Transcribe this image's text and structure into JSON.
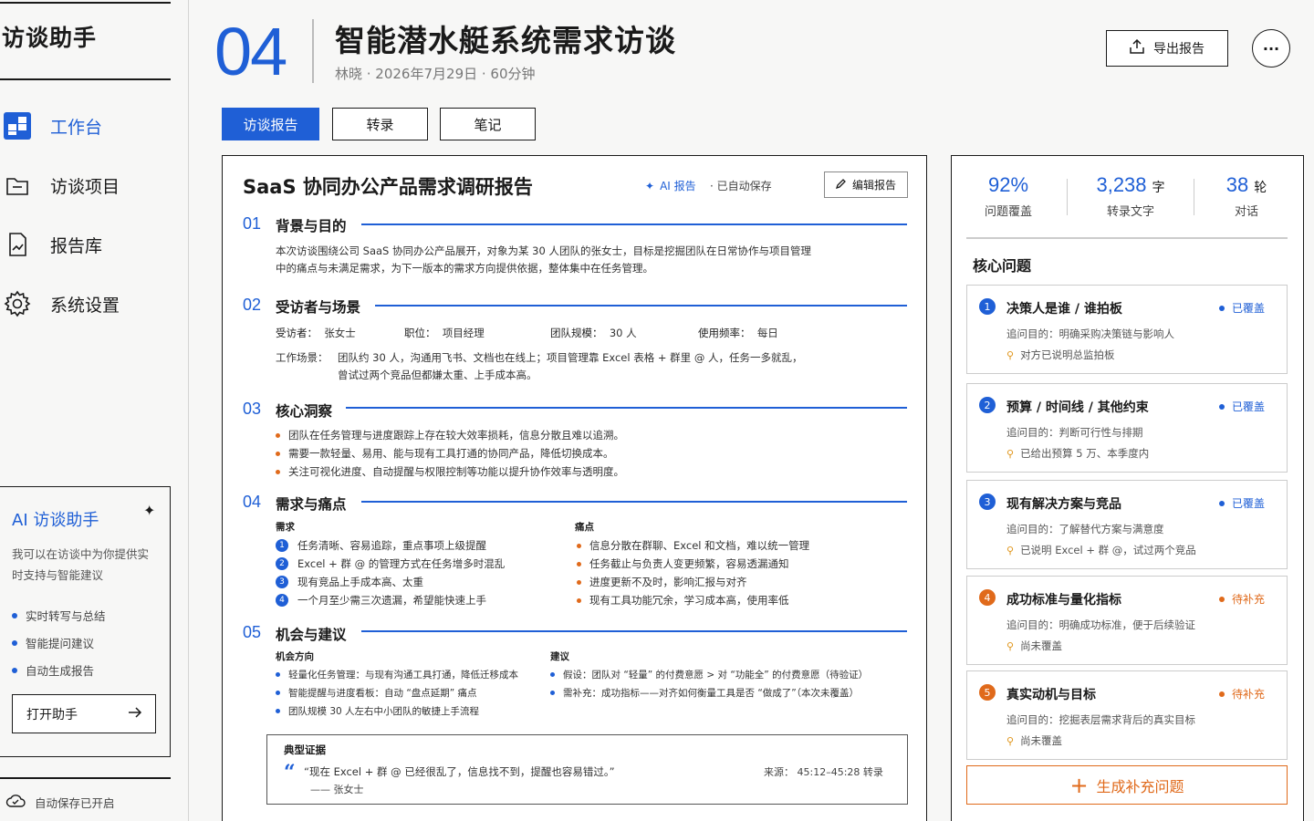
{
  "app": {
    "title": "访谈助手"
  },
  "nav": [
    {
      "label": "工作台",
      "icon": "dashboard-icon",
      "active": true
    },
    {
      "label": "访谈项目",
      "icon": "folder-icon",
      "active": false
    },
    {
      "label": "报告库",
      "icon": "document-chart-icon",
      "active": false
    },
    {
      "label": "系统设置",
      "icon": "gear-icon",
      "active": false
    }
  ],
  "assistant": {
    "title": "AI 访谈助手",
    "desc": "我可以在访谈中为你提供实时支持与智能建议",
    "features": [
      "实时转写与总结",
      "智能提问建议",
      "自动生成报告"
    ],
    "open_label": "打开助手"
  },
  "autosave": "自动保存已开启",
  "header": {
    "number": "04",
    "title": "智能潜水艇系统需求访谈",
    "meta": "林晓  ·  2026年7月29日  ·  60分钟",
    "export_label": "导出报告",
    "more_label": "···"
  },
  "tabs": [
    "访谈报告",
    "转录",
    "笔记"
  ],
  "report": {
    "title": "SaaS 协同办公产品需求调研报告",
    "ai_label": "AI 报告",
    "saved_label": "·  已自动保存",
    "edit_label": "编辑报告",
    "sections": [
      {
        "num": "01",
        "title": "背景与目的"
      },
      {
        "num": "02",
        "title": "受访者与场景"
      },
      {
        "num": "03",
        "title": "核心洞察"
      },
      {
        "num": "04",
        "title": "需求与痛点"
      },
      {
        "num": "05",
        "title": "机会与建议"
      }
    ],
    "background": [
      "本次访谈围绕公司 SaaS 协同办公产品展开，对象为某 30 人团队的张女士，目标是挖掘团队在日常协作与项目管理",
      "中的痛点与未满足需求，为下一版本的需求方向提供依据，整体集中在任务管理。"
    ],
    "interviewee": {
      "name_label": "受访者：",
      "name": "张女士",
      "role_label": "职位：",
      "role": "项目经理",
      "team_label": "团队规模：",
      "team": "30 人",
      "freq_label": "使用频率：",
      "freq": "每日",
      "scene_label": "工作场景：",
      "scene_1": "团队约 30 人，沟通用飞书、文档也在线上；项目管理靠 Excel 表格 + 群里 @ 人，任务一多就乱，",
      "scene_2": "曾试过两个竞品但都嫌太重、上手成本高。"
    },
    "insights": [
      "团队在任务管理与进度跟踪上存在较大效率损耗，信息分散且难以追溯。",
      "需要一款轻量、易用、能与现有工具打通的协同产品，降低切换成本。",
      "关注可视化进度、自动提醒与权限控制等功能以提升协作效率与透明度。"
    ],
    "needs_header": "需求",
    "needs": [
      "任务清晰、容易追踪，重点事项上级提醒",
      "Excel + 群 @ 的管理方式在任务增多时混乱",
      "现有竞品上手成本高、太重",
      "一个月至少需三次遗漏，希望能快速上手"
    ],
    "pains_header": "痛点",
    "pains": [
      "信息分散在群聊、Excel 和文档，难以统一管理",
      "任务截止与负责人变更频繁，容易透漏通知",
      "进度更新不及时，影响汇报与对齐",
      "现有工具功能冗余，学习成本高，使用率低"
    ],
    "opp_header": "机会方向",
    "opportunities": [
      "轻量化任务管理：与现有沟通工具打通，降低迁移成本",
      "智能提醒与进度看板：自动 “盘点延期” 痛点",
      "团队规模 30 人左右中小团队的敏捷上手流程"
    ],
    "sugg_header": "建议",
    "suggestions": [
      "假设：团队对 “轻量” 的付费意愿 > 对 “功能全” 的付费意愿（待验证）",
      "需补充：成功指标——对齐如何衡量工具是否 “做成了”（本次未覆盖）"
    ],
    "evidence": {
      "title": "典型证据",
      "quote": "“现在 Excel + 群 @ 已经很乱了，信息找不到，提醒也容易错过。”",
      "author": "—— 张女士",
      "source": "来源：  45:12–45:28  转录"
    }
  },
  "stats": [
    {
      "value": "92%",
      "unit": "",
      "label": "问题覆盖"
    },
    {
      "value": "3,238",
      "unit": "字",
      "label": "转录文字"
    },
    {
      "value": "38",
      "unit": "轮",
      "label": "对话"
    }
  ],
  "core": {
    "title": "核心问题",
    "questions": [
      {
        "num": "1",
        "title": "决策人是谁 / 谁拍板",
        "status": "已覆盖",
        "purpose": "追问目的：明确采购决策链与影响人",
        "note": "对方已说明总监拍板",
        "color": "#1f5fd6"
      },
      {
        "num": "2",
        "title": "预算 / 时间线 / 其他约束",
        "status": "已覆盖",
        "purpose": "追问目的：判断可行性与排期",
        "note": "已给出预算 5 万、本季度内",
        "color": "#1f5fd6"
      },
      {
        "num": "3",
        "title": "现有解决方案与竞品",
        "status": "已覆盖",
        "purpose": "追问目的：了解替代方案与满意度",
        "note": "已说明 Excel + 群 @，试过两个竞品",
        "color": "#1f5fd6"
      },
      {
        "num": "4",
        "title": "成功标准与量化指标",
        "status": "待补充",
        "purpose": "追问目的：明确成功标准，便于后续验证",
        "note": "尚未覆盖",
        "color": "#e06a1b"
      },
      {
        "num": "5",
        "title": "真实动机与目标",
        "status": "待补充",
        "purpose": "追问目的：挖掘表层需求背后的真实目标",
        "note": "尚未覆盖",
        "color": "#e06a1b"
      }
    ],
    "generate_label": "生成补充问题"
  },
  "colors": {
    "accent": "#1f5fd6",
    "warn": "#e06a1b",
    "pin": "#e0961b"
  }
}
